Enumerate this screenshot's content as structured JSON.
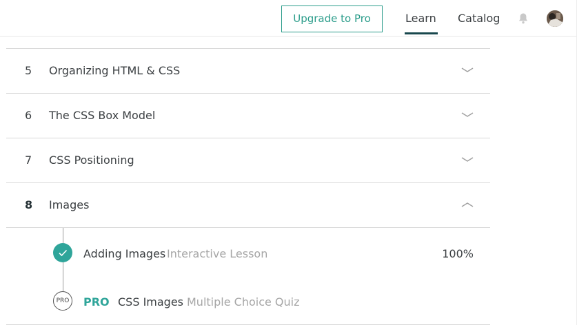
{
  "header": {
    "upgrade_label": "Upgrade to Pro",
    "nav": [
      {
        "label": "Learn",
        "active": true
      },
      {
        "label": "Catalog",
        "active": false
      }
    ],
    "icons": [
      "bell-icon",
      "avatar"
    ]
  },
  "modules": [
    {
      "number": "5",
      "title": "Organizing HTML & CSS",
      "expanded": false
    },
    {
      "number": "6",
      "title": "The CSS Box Model",
      "expanded": false
    },
    {
      "number": "7",
      "title": "CSS Positioning",
      "expanded": false
    },
    {
      "number": "8",
      "title": "Images",
      "expanded": true
    }
  ],
  "lessons": [
    {
      "title": "Adding Images",
      "type": "Interactive Lesson",
      "progress": "100%",
      "completed": true
    },
    {
      "pro_label": "PRO",
      "badge": "PRO",
      "title": "CSS Images",
      "type": "Multiple Choice Quiz",
      "completed": false
    }
  ],
  "colors": {
    "accent": "#2fa59a",
    "upgrade": "#2a9c8a",
    "nav_underline": "#18474d",
    "divider": "#d8d8d8",
    "muted_text": "#a6a6a6"
  }
}
